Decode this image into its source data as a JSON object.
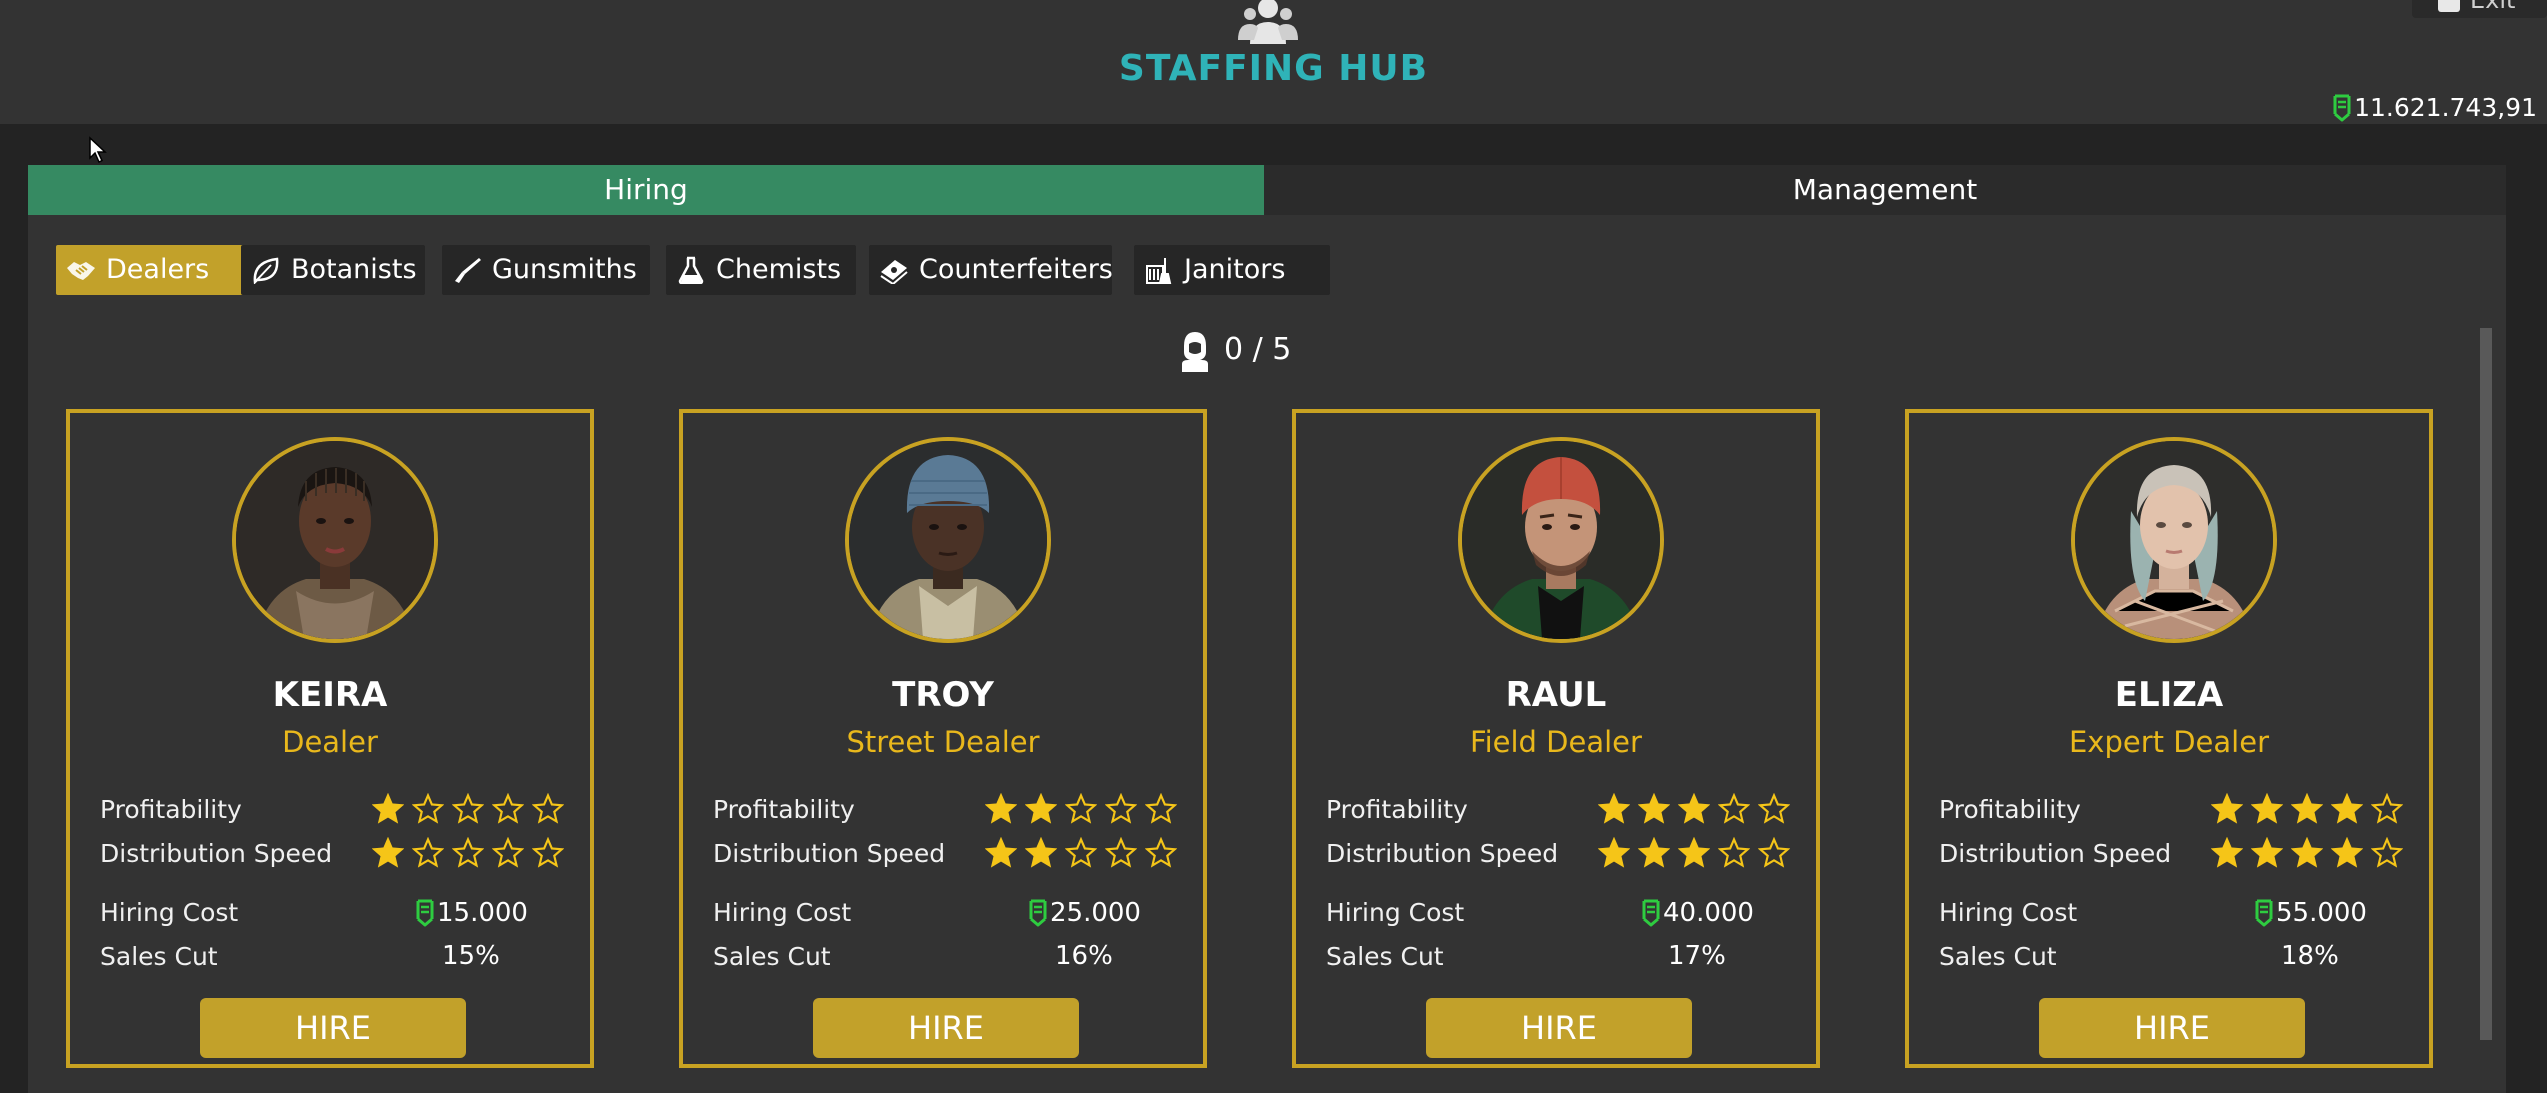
{
  "header": {
    "title": "STAFFING HUB",
    "money": "11.621.743,91",
    "exit_label": "Exit"
  },
  "tabs": [
    {
      "label": "Hiring",
      "active": true
    },
    {
      "label": "Management",
      "active": false
    }
  ],
  "categories": [
    {
      "label": "Dealers",
      "icon": "handshake-icon",
      "active": true
    },
    {
      "label": "Botanists",
      "icon": "leaf-icon",
      "active": false
    },
    {
      "label": "Gunsmiths",
      "icon": "gun-icon",
      "active": false
    },
    {
      "label": "Chemists",
      "icon": "flask-icon",
      "active": false
    },
    {
      "label": "Counterfeiters",
      "icon": "cash-stack-icon",
      "active": false
    },
    {
      "label": "Janitors",
      "icon": "broom-icon",
      "active": false
    }
  ],
  "slots": {
    "text": "0 / 5",
    "icon": "hooded-person-icon"
  },
  "labels": {
    "profitability": "Profitability",
    "distribution_speed": "Distribution Speed",
    "hiring_cost": "Hiring Cost",
    "sales_cut": "Sales Cut",
    "hire": "HIRE"
  },
  "candidates": [
    {
      "name": "KEIRA",
      "title": "Dealer",
      "profitability": 1,
      "distribution_speed": 1,
      "hiring_cost": "15.000",
      "sales_cut": "15%"
    },
    {
      "name": "TROY",
      "title": "Street Dealer",
      "profitability": 2,
      "distribution_speed": 2,
      "hiring_cost": "25.000",
      "sales_cut": "16%"
    },
    {
      "name": "RAUL",
      "title": "Field Dealer",
      "profitability": 3,
      "distribution_speed": 3,
      "hiring_cost": "40.000",
      "sales_cut": "17%"
    },
    {
      "name": "ELIZA",
      "title": "Expert Dealer",
      "profitability": 4,
      "distribution_speed": 4,
      "hiring_cost": "55.000",
      "sales_cut": "18%"
    }
  ],
  "colors": {
    "accent_gold": "#c8a222",
    "title_teal": "#2fb3b8",
    "tab_green": "#368a62",
    "star": "#f5c518",
    "cash_green": "#2ecc40",
    "rank_gold": "#e9b81c"
  }
}
